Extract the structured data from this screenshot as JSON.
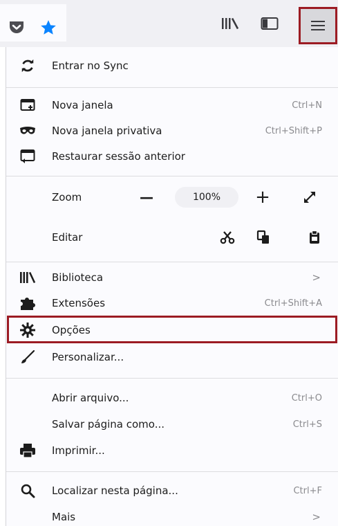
{
  "toolbar": {
    "icons": [
      "pocket-icon",
      "bookmark-star-icon",
      "library-icon",
      "sidebar-icon",
      "hamburger-menu-icon"
    ],
    "star_color": "#0a84ff",
    "highlight_color": "#9c1b23"
  },
  "menu": {
    "sync": {
      "label": "Entrar no Sync",
      "icon": "sync-icon"
    },
    "new_window": {
      "label": "Nova janela",
      "shortcut": "Ctrl+N",
      "icon": "new-window-icon"
    },
    "private_window": {
      "label": "Nova janela privativa",
      "shortcut": "Ctrl+Shift+P",
      "icon": "private-mask-icon"
    },
    "restore_session": {
      "label": "Restaurar sessão anterior",
      "icon": "restore-session-icon"
    },
    "zoom": {
      "label": "Zoom",
      "minus": "—",
      "value": "100%",
      "plus": "+",
      "fullscreen_icon": "expand-icon"
    },
    "edit": {
      "label": "Editar",
      "icons": [
        "scissors-icon",
        "copy-icon",
        "paste-icon"
      ]
    },
    "library": {
      "label": "Biblioteca",
      "chevron": ">",
      "icon": "library-icon"
    },
    "addons": {
      "label": "Extensões",
      "shortcut": "Ctrl+Shift+A",
      "icon": "puzzle-icon"
    },
    "options": {
      "label": "Opções",
      "icon": "gear-icon"
    },
    "customize": {
      "label": "Personalizar...",
      "icon": "paintbrush-icon"
    },
    "open_file": {
      "label": "Abrir arquivo...",
      "shortcut": "Ctrl+O"
    },
    "save_page": {
      "label": "Salvar página como...",
      "shortcut": "Ctrl+S"
    },
    "print": {
      "label": "Imprimir...",
      "icon": "printer-icon"
    },
    "find": {
      "label": "Localizar nesta página...",
      "shortcut": "Ctrl+F",
      "icon": "magnifier-icon"
    },
    "more": {
      "label": "Mais",
      "chevron": ">"
    }
  }
}
